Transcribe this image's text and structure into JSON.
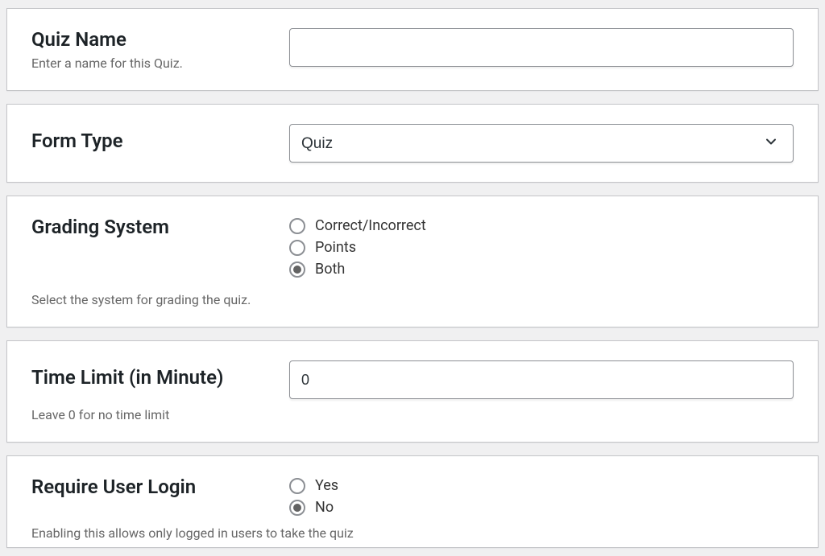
{
  "quizName": {
    "label": "Quiz Name",
    "hint": "Enter a name for this Quiz.",
    "value": ""
  },
  "formType": {
    "label": "Form Type",
    "selected": "Quiz",
    "options": [
      "Quiz"
    ]
  },
  "gradingSystem": {
    "label": "Grading System",
    "hint": "Select the system for grading the quiz.",
    "options": [
      {
        "label": "Correct/Incorrect",
        "checked": false
      },
      {
        "label": "Points",
        "checked": false
      },
      {
        "label": "Both",
        "checked": true
      }
    ]
  },
  "timeLimit": {
    "label": "Time Limit (in Minute)",
    "hint": "Leave 0 for no time limit",
    "value": "0"
  },
  "requireLogin": {
    "label": "Require User Login",
    "hint": "Enabling this allows only logged in users to take the quiz",
    "options": [
      {
        "label": "Yes",
        "checked": false
      },
      {
        "label": "No",
        "checked": true
      }
    ]
  }
}
